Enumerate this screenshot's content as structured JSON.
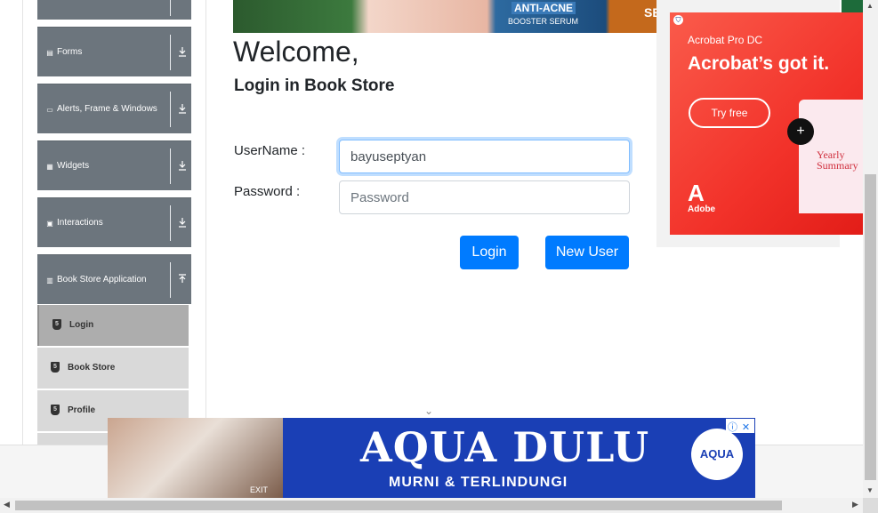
{
  "sidebar": {
    "groups": [
      {
        "label": "Forms",
        "icon": "form-icon",
        "arrow": "download-icon"
      },
      {
        "label": "Alerts, Frame & Windows",
        "icon": "window-icon",
        "arrow": "download-icon"
      },
      {
        "label": "Widgets",
        "icon": "grid-icon",
        "arrow": "download-icon"
      },
      {
        "label": "Interactions",
        "icon": "interaction-icon",
        "arrow": "download-icon"
      },
      {
        "label": "Book Store Application",
        "icon": "book-icon",
        "arrow": "upload-icon"
      }
    ],
    "items": [
      {
        "label": "Login",
        "icon": "html5-icon",
        "active": true
      },
      {
        "label": "Book Store",
        "icon": "html5-icon",
        "active": false
      },
      {
        "label": "Profile",
        "icon": "html5-icon",
        "active": false
      }
    ]
  },
  "main": {
    "title": "Welcome,",
    "subtitle": "Login in Book Store",
    "username_label": "UserName :",
    "username_value": "bayuseptyan",
    "password_label": "Password :",
    "password_placeholder": "Password",
    "login_button": "Login",
    "new_user_button": "New User"
  },
  "ads": {
    "top": {
      "text1": "ANTI-ACNE",
      "text2": "BOOSTER SERUM",
      "text3": "SEJA"
    },
    "acrobat": {
      "product": "Acrobat Pro DC",
      "headline": "Acrobat’s got it.",
      "cta": "Try free",
      "preview_text": "Yearly Summary",
      "brand": "Adobe"
    },
    "bottom": {
      "brand": "AQUA DULU",
      "tagline": "MURNI & TERLINDUNGI",
      "logo": "AQUA",
      "exit": "EXIT"
    }
  },
  "colors": {
    "primary": "#007bff",
    "sidebar": "#6c757d",
    "acrobat_red": "#f2322a",
    "aqua_blue": "#1a3fb5"
  }
}
